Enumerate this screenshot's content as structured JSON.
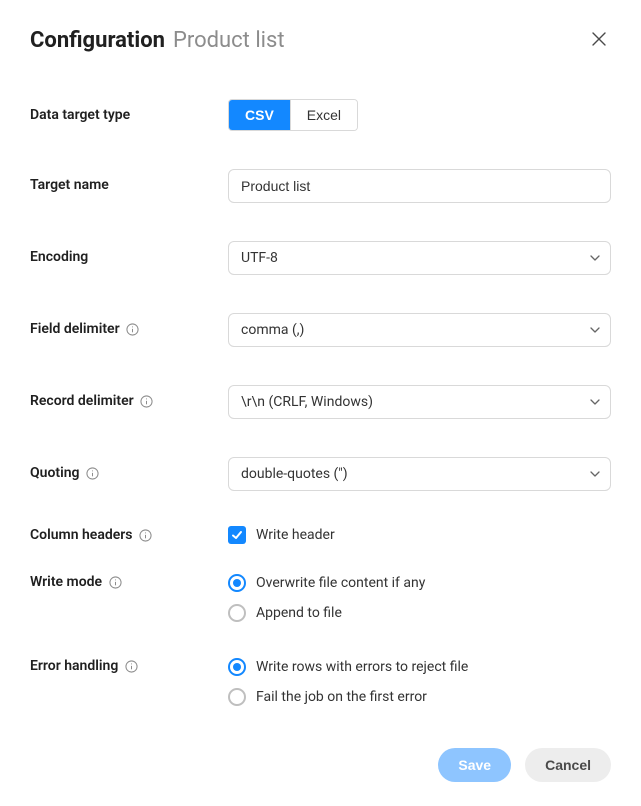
{
  "header": {
    "title": "Configuration",
    "subtitle": "Product list"
  },
  "fields": {
    "data_target_type": {
      "label": "Data target type",
      "options": {
        "csv": "CSV",
        "excel": "Excel"
      },
      "selected": "csv"
    },
    "target_name": {
      "label": "Target name",
      "value": "Product list"
    },
    "encoding": {
      "label": "Encoding",
      "value": "UTF-8"
    },
    "field_delimiter": {
      "label": "Field delimiter",
      "value": "comma (,)"
    },
    "record_delimiter": {
      "label": "Record delimiter",
      "value": "\\r\\n (CRLF, Windows)"
    },
    "quoting": {
      "label": "Quoting",
      "value": "double-quotes (\")"
    },
    "column_headers": {
      "label": "Column headers",
      "checkbox_label": "Write header",
      "checked": true
    },
    "write_mode": {
      "label": "Write mode",
      "options": {
        "overwrite": "Overwrite file content if any",
        "append": "Append to file"
      },
      "selected": "overwrite"
    },
    "error_handling": {
      "label": "Error handling",
      "options": {
        "reject": "Write rows with errors to reject file",
        "fail": "Fail the job on the first error"
      },
      "selected": "reject"
    }
  },
  "footer": {
    "save": "Save",
    "cancel": "Cancel"
  }
}
